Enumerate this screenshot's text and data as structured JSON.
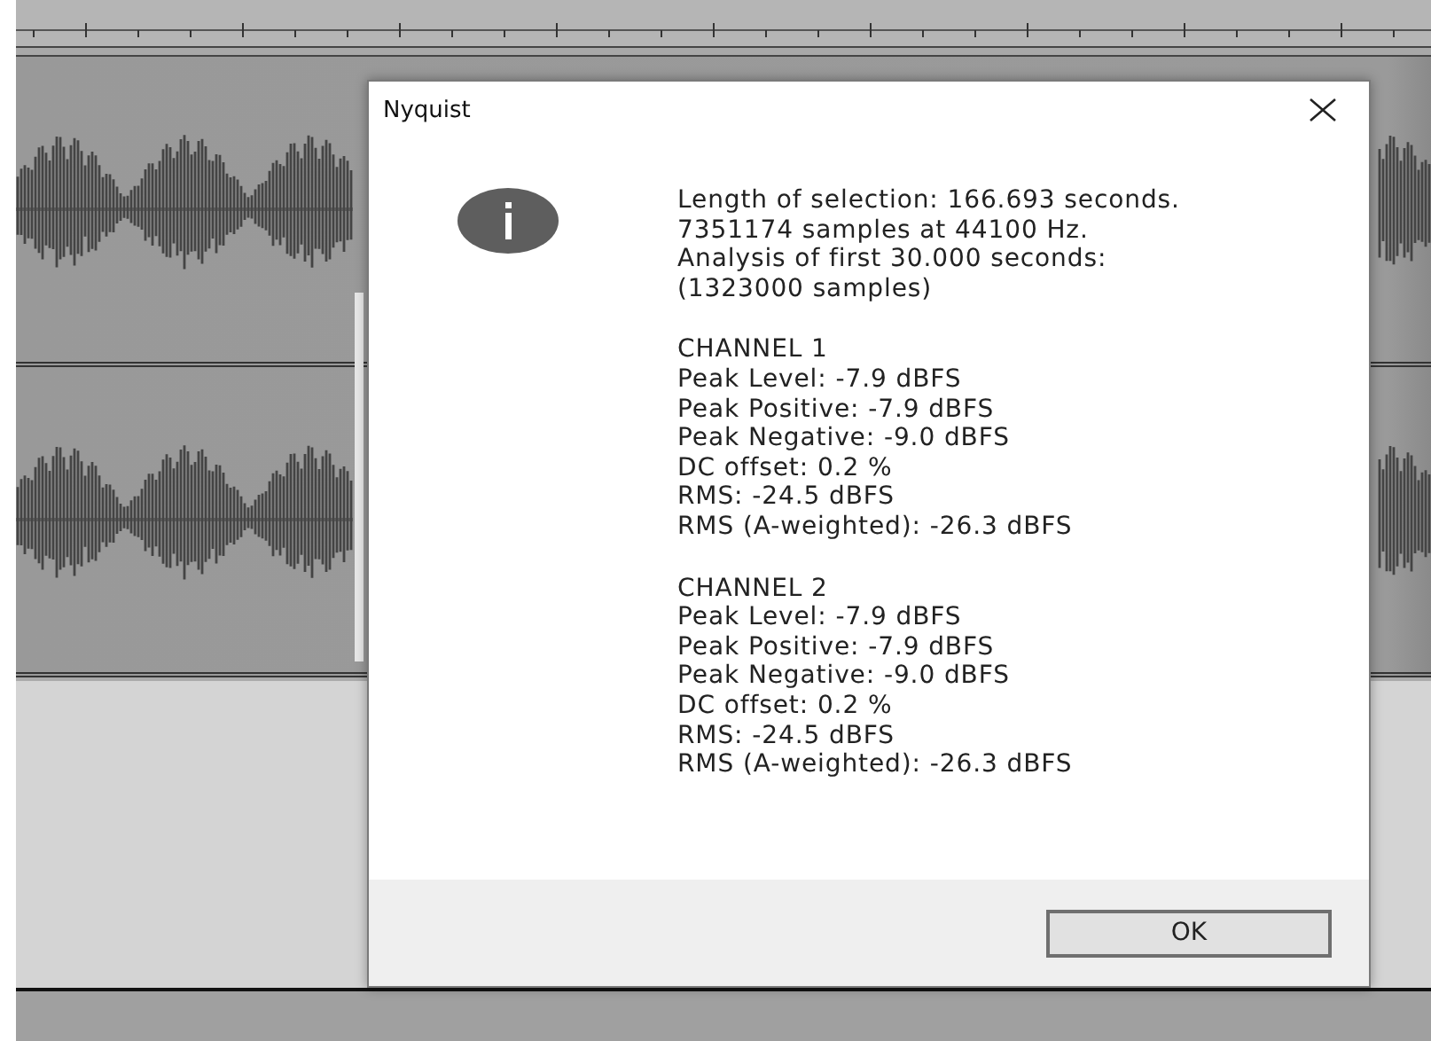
{
  "dialog": {
    "title": "Nyquist",
    "summary": [
      "Length of selection: 166.693 seconds.",
      "7351174 samples at 44100 Hz.",
      "Analysis of first 30.000 seconds:",
      "(1323000 samples)"
    ],
    "channels": [
      {
        "title": "CHANNEL 1",
        "lines": [
          "Peak Level: -7.9 dBFS",
          "Peak Positive: -7.9 dBFS",
          "Peak Negative: -9.0 dBFS",
          "DC offset: 0.2 %",
          "RMS: -24.5 dBFS",
          "RMS (A-weighted): -26.3 dBFS"
        ]
      },
      {
        "title": "CHANNEL 2",
        "lines": [
          "Peak Level: -7.9 dBFS",
          "Peak Positive: -7.9 dBFS",
          "Peak Negative: -9.0 dBFS",
          "DC offset: 0.2 %",
          "RMS: -24.5 dBFS",
          "RMS (A-weighted): -26.3 dBFS"
        ]
      }
    ],
    "buttons": [
      "OK"
    ]
  }
}
